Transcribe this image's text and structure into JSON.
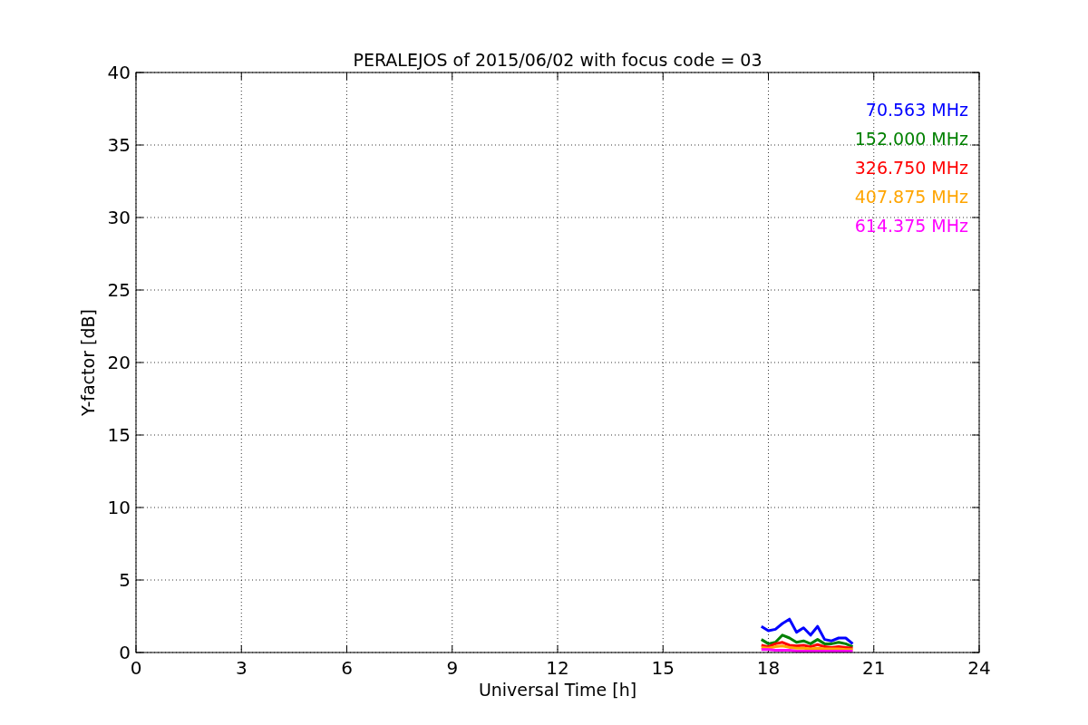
{
  "chart_data": {
    "type": "line",
    "title": "PERALEJOS of 2015/06/02 with focus code = 03",
    "xlabel": "Universal Time [h]",
    "ylabel": "Y-factor [dB]",
    "x": [
      17.8,
      18.0,
      18.2,
      18.4,
      18.6,
      18.8,
      19.0,
      19.2,
      19.4,
      19.6,
      19.8,
      20.0,
      20.2,
      20.4
    ],
    "series": [
      {
        "name": "70.563 MHz",
        "color": "#0000ff",
        "values": [
          1.8,
          1.5,
          1.6,
          2.0,
          2.3,
          1.4,
          1.7,
          1.2,
          1.8,
          0.9,
          0.8,
          1.0,
          1.0,
          0.6
        ]
      },
      {
        "name": "152.000 MHz",
        "color": "#008000",
        "values": [
          0.9,
          0.6,
          0.7,
          1.2,
          1.0,
          0.7,
          0.8,
          0.6,
          0.9,
          0.6,
          0.6,
          0.7,
          0.6,
          0.4
        ]
      },
      {
        "name": "326.750 MHz",
        "color": "#ff0000",
        "values": [
          0.5,
          0.4,
          0.6,
          0.7,
          0.5,
          0.45,
          0.5,
          0.4,
          0.55,
          0.4,
          0.35,
          0.4,
          0.35,
          0.3
        ]
      },
      {
        "name": "407.875 MHz",
        "color": "#ffa500",
        "values": [
          0.35,
          0.3,
          0.4,
          0.45,
          0.35,
          0.3,
          0.3,
          0.25,
          0.3,
          0.25,
          0.25,
          0.25,
          0.2,
          0.2
        ]
      },
      {
        "name": "614.375 MHz",
        "color": "#ff00ff",
        "values": [
          0.2,
          0.2,
          0.15,
          0.15,
          0.15,
          0.1,
          0.1,
          0.1,
          0.1,
          0.1,
          0.1,
          0.1,
          0.1,
          0.1
        ]
      }
    ],
    "grid": true,
    "xlim": [
      0,
      24
    ],
    "ylim": [
      0,
      40
    ],
    "xticks": [
      0,
      3,
      6,
      9,
      12,
      15,
      18,
      21,
      24
    ],
    "yticks": [
      0,
      5,
      10,
      15,
      20,
      25,
      30,
      35,
      40
    ]
  }
}
